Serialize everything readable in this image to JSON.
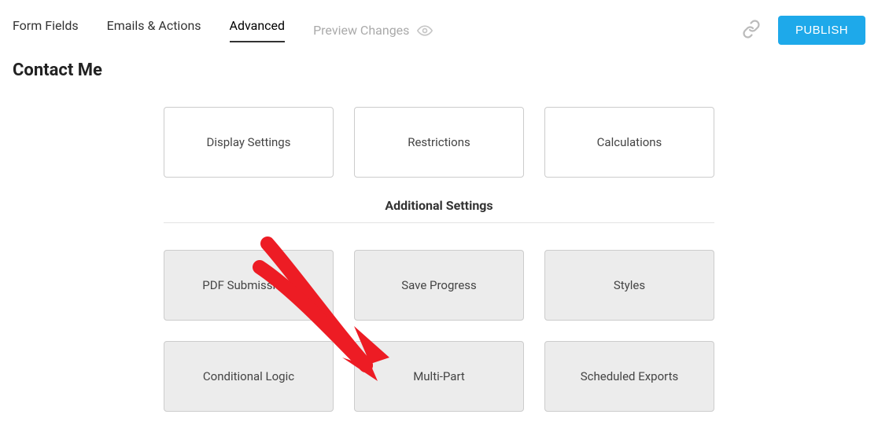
{
  "tabs": {
    "form_fields": "Form Fields",
    "emails_actions": "Emails & Actions",
    "advanced": "Advanced",
    "preview": "Preview Changes"
  },
  "publish_label": "PUBLISH",
  "page_title": "Contact Me",
  "cards": {
    "display_settings": "Display Settings",
    "restrictions": "Restrictions",
    "calculations": "Calculations",
    "section_title": "Additional Settings",
    "pdf_submissions": "PDF Submissions",
    "save_progress": "Save Progress",
    "styles": "Styles",
    "conditional_logic": "Conditional Logic",
    "multi_part": "Multi-Part",
    "scheduled_exports": "Scheduled Exports"
  }
}
